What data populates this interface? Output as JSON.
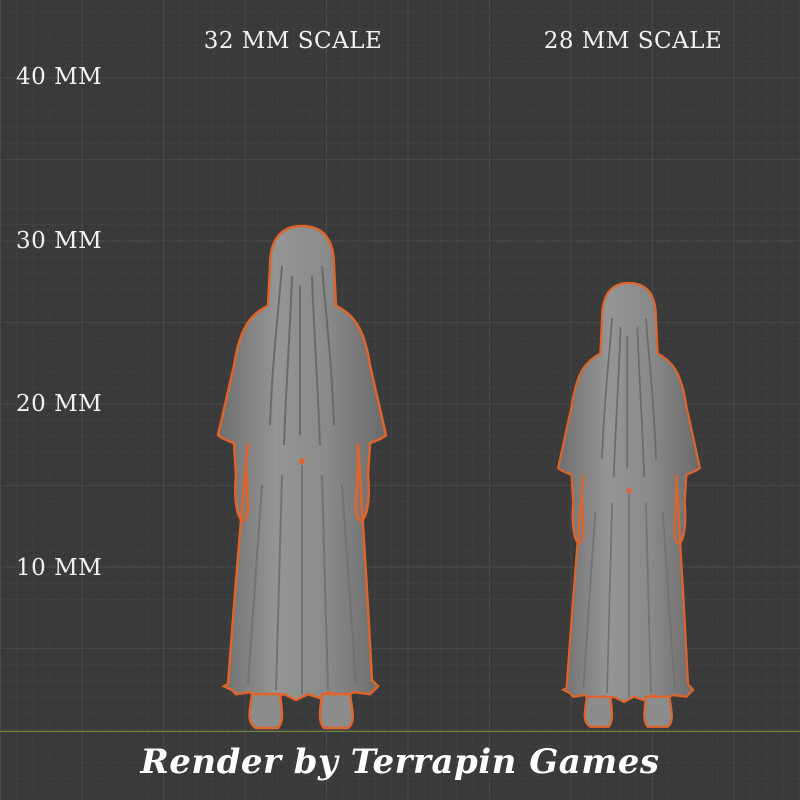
{
  "axis": {
    "labels": [
      {
        "text": "40 MM",
        "value": 40
      },
      {
        "text": "30 MM",
        "value": 30
      },
      {
        "text": "20 MM",
        "value": 20
      },
      {
        "text": "10 MM",
        "value": 10
      }
    ]
  },
  "figures": [
    {
      "label": "32 MM SCALE",
      "height_mm": 30.3
    },
    {
      "label": "28 MM SCALE",
      "height_mm": 26.8
    }
  ],
  "credit": "Render by Terrapin Games",
  "colors": {
    "background": "#3a3a3a",
    "figure_fill": "#8c8c8c",
    "selection_outline": "#e0642a",
    "ground_line": "#6f8a3a",
    "text": "#f2f2f2"
  }
}
